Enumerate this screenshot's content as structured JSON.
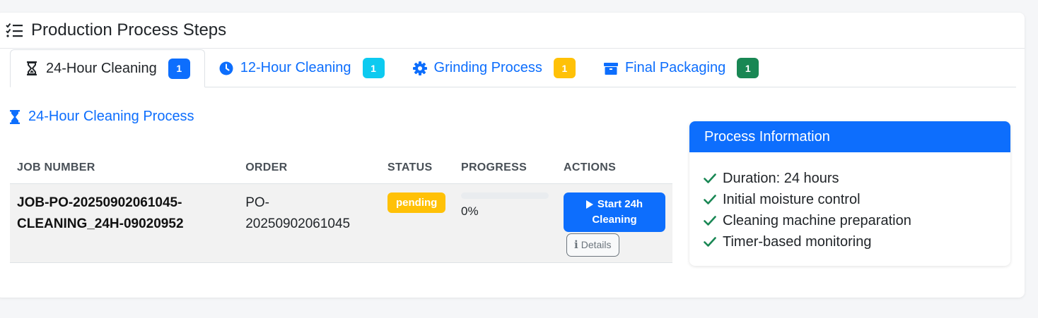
{
  "header": {
    "title": "Production Process Steps",
    "icon": "tasks-icon"
  },
  "tabs": [
    {
      "label": "24-Hour Cleaning",
      "count": "1",
      "icon": "hourglass-icon",
      "badge_color": "#0d6efd",
      "active": true
    },
    {
      "label": "12-Hour Cleaning",
      "count": "1",
      "icon": "clock-icon",
      "badge_color": "#0dcaf0",
      "active": false
    },
    {
      "label": "Grinding Process",
      "count": "1",
      "icon": "gear-icon",
      "badge_color": "#ffc107",
      "active": false
    },
    {
      "label": "Final Packaging",
      "count": "1",
      "icon": "box-icon",
      "badge_color": "#198754",
      "active": false
    }
  ],
  "section": {
    "title": "24-Hour Cleaning Process"
  },
  "table": {
    "columns": [
      "JOB NUMBER",
      "ORDER",
      "STATUS",
      "PROGRESS",
      "ACTIONS"
    ],
    "rows": [
      {
        "job_number_line1": "JOB-PO-20250902061045-",
        "job_number_line2": "CLEANING_24H-09020952",
        "order_line1": "PO-",
        "order_line2": "20250902061045",
        "status": "pending",
        "progress_value": 0,
        "progress_text": "0%",
        "start_label_line1": "Start 24h",
        "start_label_line2": "Cleaning",
        "details_label": "Details"
      }
    ]
  },
  "info": {
    "title": "Process Information",
    "items": [
      "Duration: 24 hours",
      "Initial moisture control",
      "Cleaning machine preparation",
      "Timer-based monitoring"
    ]
  },
  "colors": {
    "primary": "#0d6efd",
    "warning": "#ffc107",
    "info": "#0dcaf0",
    "success": "#198754",
    "check": "#198754"
  }
}
